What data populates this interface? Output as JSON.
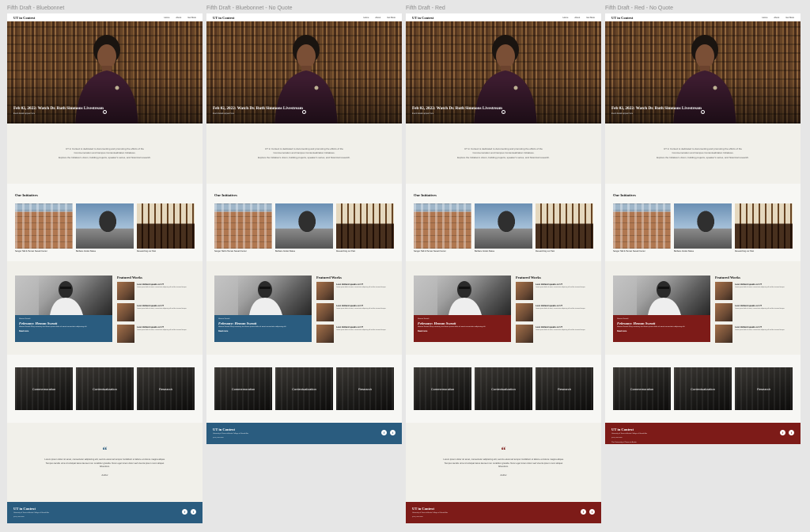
{
  "frames": [
    {
      "title": "Fifth Draft - Bluebonnet",
      "accent": "#2a5c7f",
      "show_quote": true
    },
    {
      "title": "Fifth Draft - Bluebonnet - No Quote",
      "accent": "#2a5c7f",
      "show_quote": false
    },
    {
      "title": "Fifth Draft - Red",
      "accent": "#7d1b18",
      "show_quote": true
    },
    {
      "title": "Fifth Draft - Red - No Quote",
      "accent": "#7d1b18",
      "show_quote": false
    }
  ],
  "nav": {
    "brand": "UT in Context",
    "links": [
      "Home",
      "About",
      "Get More"
    ]
  },
  "hero": {
    "title": "Feb 02, 2022: Watch Dr. Ruth Simmons Livestream",
    "subtitle": "Event details appear here",
    "arrow_icon": "arrow-right-icon"
  },
  "mission": {
    "line1": "UT in Context is dedicated to documenting and promoting the efforts of the",
    "line2": "Commemoration and Campus Contextualization Initiatives.",
    "line3": "Explore the Initiative's vision, building projects, speaker's series, and historical research."
  },
  "initiatives": {
    "title": "Our Initiatives",
    "items": [
      {
        "caption": "Sanger Hall & Heman Sweatt Center"
      },
      {
        "caption": "Barbara Jordan Statue"
      },
      {
        "caption": "Researching our Past"
      }
    ]
  },
  "featured": {
    "title": "Featured Works",
    "main": {
      "eyebrow": "Heman Sweatt",
      "title": "February: Heman Sweatt",
      "body": "Heman Sweatt story summary text lorem ipsum dolor sit amet consectetur adipiscing elit.",
      "more": "Read more"
    },
    "items": [
      {
        "title": "Leon Holland speaks on UT",
        "desc": "Lorem ipsum dolor sit amet, consectetur adipiscing elit sed do eiusmod tempor."
      },
      {
        "title": "Leon Holland speaks on UT",
        "desc": "Lorem ipsum dolor sit amet, consectetur adipiscing elit sed do eiusmod tempor."
      },
      {
        "title": "Leon Holland speaks on UT",
        "desc": "Lorem ipsum dolor sit amet, consectetur adipiscing elit sed do eiusmod tempor."
      }
    ]
  },
  "categories": [
    "Commemoration",
    "Contextualization",
    "Research"
  ],
  "quote": {
    "mark": "“",
    "text": "Lorem ipsum dolor sit amet, consectetur adipiscing elit, sed do eiusmod tempor incididunt ut labore et dolore magna aliqua. Tempus iaculis urna id volutpat lacus laoreet non curabitur gravida. Nunc eget lorem dolor sed viverra ipsum nunc aliquet bibendum.",
    "author": "Author"
  },
  "footer": {
    "brand": "UT in Context",
    "address": "University of Texas at Austin College of Liberal Arts",
    "phone": "(000) 000-0000",
    "logo_text": "The University of Texas at Austin",
    "icons": [
      "facebook-icon",
      "twitter-icon"
    ]
  },
  "colors": {
    "page_bg": "#e6e6e6",
    "section_light": "#f7f7f4",
    "section_beige": "#f1f0ea"
  }
}
